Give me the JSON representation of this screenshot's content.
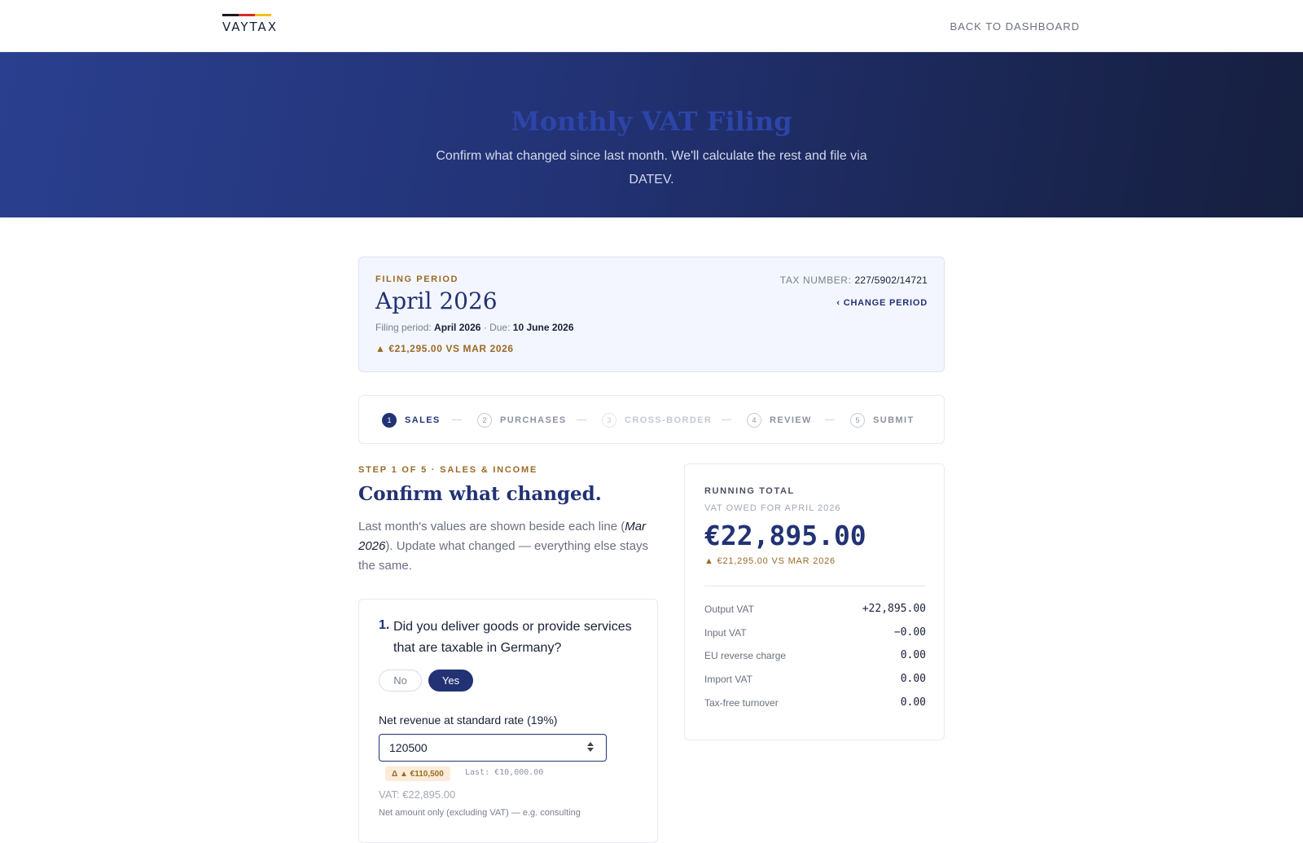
{
  "brand": {
    "name": "VAYTAX",
    "stripe_colors": [
      "#1a1a1a",
      "#d62b2b",
      "#f2c21b"
    ]
  },
  "nav": {
    "back_label": "BACK TO DASHBOARD"
  },
  "hero": {
    "title": "Monthly VAT Filing",
    "subtitle": "Confirm what changed since last month. We'll calculate the rest and file via DATEV."
  },
  "period": {
    "eyebrow": "FILING PERIOD",
    "title": "April 2026",
    "meta_period_label": "Filing period:",
    "meta_period_value": "April 2026",
    "meta_due_label": "· Due:",
    "meta_due_value": "10 June 2026",
    "delta": "▲ €21,295.00 VS MAR 2026",
    "tax_number_label": "TAX NUMBER:",
    "tax_number_value": "227/5902/14721",
    "change_label": "‹ CHANGE PERIOD"
  },
  "stepper": {
    "steps": [
      {
        "num": "1",
        "label": "SALES",
        "state": "active"
      },
      {
        "num": "2",
        "label": "PURCHASES",
        "state": "pending"
      },
      {
        "num": "3",
        "label": "CROSS-BORDER",
        "state": "disabled"
      },
      {
        "num": "4",
        "label": "REVIEW",
        "state": "pending"
      },
      {
        "num": "5",
        "label": "SUBMIT",
        "state": "pending"
      }
    ]
  },
  "section": {
    "eyebrow": "STEP 1 OF 5 · SALES & INCOME",
    "title": "Confirm what changed.",
    "intro_pre": "Last month's values are shown beside each line (",
    "intro_em": "Mar 2026",
    "intro_post": "). Update what changed — everything else stays the same."
  },
  "question": {
    "number": "1.",
    "text": "Did you deliver goods or provide services that are taxable in Germany?",
    "option_no": "No",
    "option_yes": "Yes",
    "selected": "Yes",
    "field_label": "Net revenue at standard rate (19%)",
    "field_value": "120500",
    "delta_badge": "Δ ▲ €110,500",
    "last_value": "Last: €10,000.00",
    "vat_line": "VAT: €22,895.00",
    "help_text": "Net amount only (excluding VAT) — e.g. consulting"
  },
  "running_total": {
    "eyebrow": "RUNNING TOTAL",
    "subtitle": "VAT OWED FOR APRIL 2026",
    "amount": "€22,895.00",
    "delta": "▲ €21,295.00 VS MAR 2026",
    "rows": [
      {
        "label": "Output VAT",
        "value": "+22,895.00"
      },
      {
        "label": "Input VAT",
        "value": "−0.00"
      },
      {
        "label": "EU reverse charge",
        "value": "0.00"
      },
      {
        "label": "Import VAT",
        "value": "0.00"
      },
      {
        "label": "Tax-free turnover",
        "value": "0.00"
      }
    ]
  },
  "colors": {
    "accent": "#223274",
    "gold": "#9a6a26",
    "period_bg": "#f3f6fe"
  }
}
